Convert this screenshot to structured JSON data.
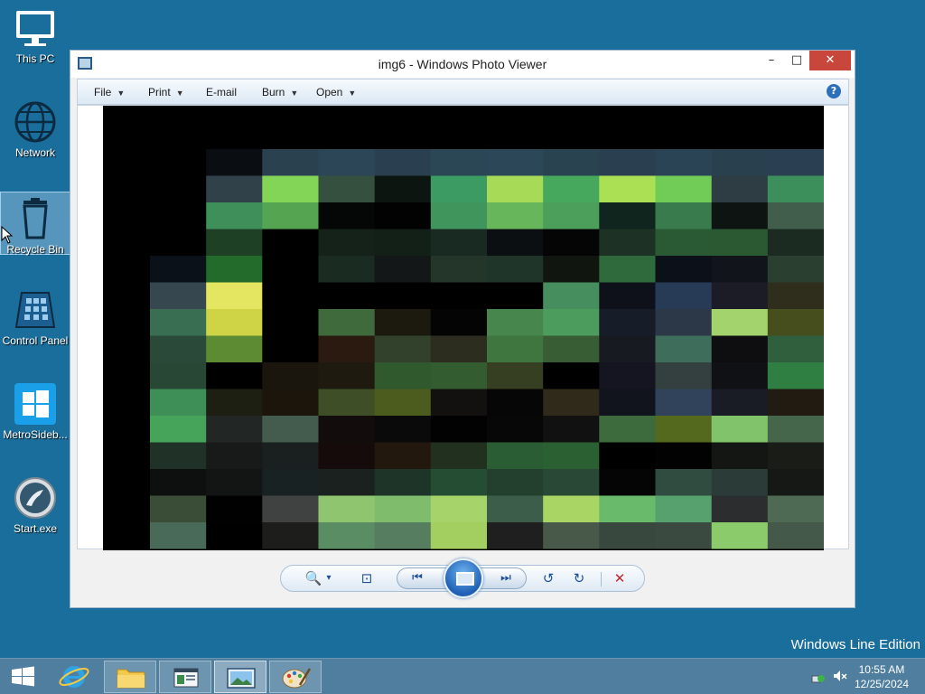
{
  "desktop": {
    "icons": [
      {
        "label": "This PC"
      },
      {
        "label": "Network"
      },
      {
        "label": "Recycle Bin"
      },
      {
        "label": "Control Panel"
      },
      {
        "label": "MetroSideb..."
      },
      {
        "label": "Start.exe"
      }
    ],
    "edition": "Windows Line Edition"
  },
  "window": {
    "title": "img6 - Windows Photo Viewer",
    "minimize": "–",
    "maximize": "□",
    "close": "✕",
    "menu": [
      {
        "label": "File",
        "caret": "▼"
      },
      {
        "label": "Print",
        "caret": "▼"
      },
      {
        "label": "E-mail",
        "caret": ""
      },
      {
        "label": "Burn",
        "caret": "▼"
      },
      {
        "label": "Open",
        "caret": "▼"
      }
    ],
    "help": "?",
    "controls": {
      "zoom": "🔍",
      "zoom_caret": "▾",
      "actual_size": "⊡",
      "previous": "⏮",
      "next": "⏭",
      "rotate_ccw": "↺",
      "rotate_cw": "↻",
      "delete": "✕"
    },
    "image_colors": {
      "grid": [
        [
          "#000000",
          "#000000",
          "#0a0d12",
          "#2a4150",
          "#2c4658",
          "#2a4050",
          "#2b4655",
          "#2c4758",
          "#2a4350",
          "#2a3f4f",
          "#2b4455",
          "#29404e",
          "#2b3f52"
        ],
        [
          "#000000",
          "#000000",
          "#30414a",
          "#83d557",
          "#36503f",
          "#0d1510",
          "#3b9b63",
          "#a7da56",
          "#45a85c",
          "#ace054",
          "#71cb57",
          "#2e3c43",
          "#3c8f5b"
        ],
        [
          "#000000",
          "#000000",
          "#3f8f5a",
          "#54a452",
          "#050606",
          "#020202",
          "#3f955b",
          "#68b65c",
          "#4c9e5b",
          "#10251d",
          "#3a7b4e",
          "#0e1412",
          "#415d4c"
        ],
        [
          "#000000",
          "#000000",
          "#1e4126",
          "#000000",
          "#142219",
          "#132018",
          "#182a21",
          "#0c0f12",
          "#050505",
          "#1d3225",
          "#2a5a33",
          "#2b5a32",
          "#1c2b22"
        ],
        [
          "#000000",
          "#0a1118",
          "#236b2b",
          "#000000",
          "#1a2b22",
          "#141717",
          "#24362a",
          "#1f352a",
          "#101510",
          "#2e6a3c",
          "#0b1019",
          "#12141c",
          "#2b3f31"
        ],
        [
          "#000000",
          "#37474f",
          "#e4e662",
          "#000000",
          "#000000",
          "#000000",
          "#000000",
          "#000000",
          "#468e5e",
          "#0f111a",
          "#273b57",
          "#1c1c26",
          "#2f2d1c"
        ],
        [
          "#000000",
          "#396e52",
          "#cfd447",
          "#000000",
          "#3f6a3b",
          "#1c1a0e",
          "#040404",
          "#47874e",
          "#4c9c5d",
          "#161c28",
          "#2c3847",
          "#a3d36c",
          "#474e1e"
        ],
        [
          "#000000",
          "#2b4938",
          "#5d8b33",
          "#000000",
          "#2a1a0f",
          "#31412b",
          "#2c2c1f",
          "#3f7640",
          "#385d34",
          "#171a20",
          "#3f6d5b",
          "#0e0d10",
          "#2f5f3c"
        ],
        [
          "#000000",
          "#294735",
          "#000000",
          "#1a160e",
          "#1f1a10",
          "#305a2d",
          "#335c31",
          "#363f22",
          "#000000",
          "#141520",
          "#33403f",
          "#0f1115",
          "#2f7e42"
        ],
        [
          "#000000",
          "#3e8e58",
          "#1e1f13",
          "#1b150c",
          "#3e4f28",
          "#4c5c1e",
          "#121110",
          "#060606",
          "#2f2a1a",
          "#11141c",
          "#31435b",
          "#191b25",
          "#211b12"
        ],
        [
          "#000000",
          "#46a35a",
          "#222625",
          "#435c4e",
          "#120c0c",
          "#0a0a0a",
          "#020202",
          "#070707",
          "#111111",
          "#3d6b3e",
          "#54691e",
          "#81c36b",
          "#45664a"
        ],
        [
          "#000000",
          "#203128",
          "#181a19",
          "#19201f",
          "#150b0a",
          "#22180e",
          "#22301f",
          "#2b5d35",
          "#2b6032",
          "#000000",
          "#020202",
          "#141613",
          "#1a1c17"
        ],
        [
          "#000000",
          "#0e1010",
          "#131515",
          "#192223",
          "#1a211f",
          "#1f3428",
          "#244d34",
          "#22402d",
          "#294835",
          "#050505",
          "#304b3f",
          "#2b3c38",
          "#161816"
        ],
        [
          "#000000",
          "#3a4d37",
          "#010101",
          "#404141",
          "#8fc56e",
          "#7fbd6d",
          "#a6d46b",
          "#3c5d4a",
          "#a8d563",
          "#69ba6b",
          "#57a16e",
          "#2b2d2f",
          "#4e6a54"
        ],
        [
          "#000000",
          "#4a6a59",
          "#000000",
          "#1d1d1b",
          "#5b8d64",
          "#567d5f",
          "#a3cf60",
          "#1e1f1e",
          "#495949",
          "#39483f",
          "#3a4a40",
          "#8ccb6c",
          "#44594a"
        ],
        [
          "#000000",
          "#000000",
          "#000000",
          "#000000",
          "#000000",
          "#000000",
          "#000000",
          "#000000",
          "#000000",
          "#000000",
          "#000000",
          "#000000",
          "#000000"
        ]
      ]
    }
  },
  "taskbar": {
    "time": "10:55 AM",
    "date": "12/25/2024"
  }
}
